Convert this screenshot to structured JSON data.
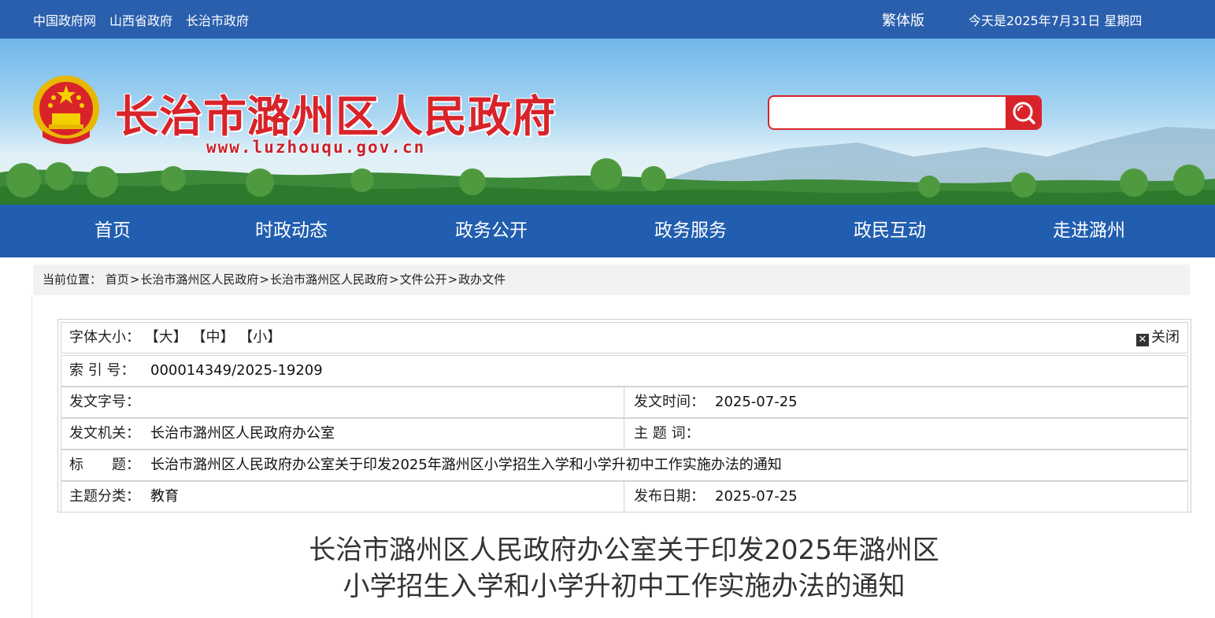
{
  "topbar": {
    "links": [
      "中国政府网",
      "山西省政府",
      "长治市政府"
    ],
    "traditional": "繁体版",
    "date": "今天是2025年7月31日 星期四"
  },
  "banner": {
    "title": "长治市潞州区人民政府",
    "url": "www.luzhouqu.gov.cn",
    "search_placeholder": ""
  },
  "nav": [
    "首页",
    "时政动态",
    "政务公开",
    "政务服务",
    "政民互动",
    "走进潞州"
  ],
  "breadcrumb": {
    "label": "当前位置：",
    "items": [
      "首页",
      "长治市潞州区人民政府",
      "长治市潞州区人民政府",
      "文件公开",
      "政办文件"
    ],
    "sep": ">"
  },
  "info": {
    "font_size_label": "字体大小：",
    "font_large": "【大】",
    "font_medium": "【中】",
    "font_small": "【小】",
    "close": "关闭",
    "index_label": "索 引 号：",
    "index_value": "000014349/2025-19209",
    "doc_no_label": "发文字号：",
    "doc_no_value": "",
    "issue_time_label": "发文时间：",
    "issue_time_value": "2025-07-25",
    "agency_label": "发文机关：",
    "agency_value": "长治市潞州区人民政府办公室",
    "subject_label": "主 题 词：",
    "subject_value": "",
    "title_label": "标　　题：",
    "title_value": "长治市潞州区人民政府办公室关于印发2025年潞州区小学招生入学和小学升初中工作实施办法的通知",
    "category_label": "主题分类：",
    "category_value": "教育",
    "publish_label": "发布日期：",
    "publish_value": "2025-07-25"
  },
  "document": {
    "title_line1": "长治市潞州区人民政府办公室关于印发2025年潞州区",
    "title_line2": "小学招生入学和小学升初中工作实施办法的通知"
  },
  "colors": {
    "brand_blue": "#215eaf",
    "brand_red": "#d9232a"
  }
}
